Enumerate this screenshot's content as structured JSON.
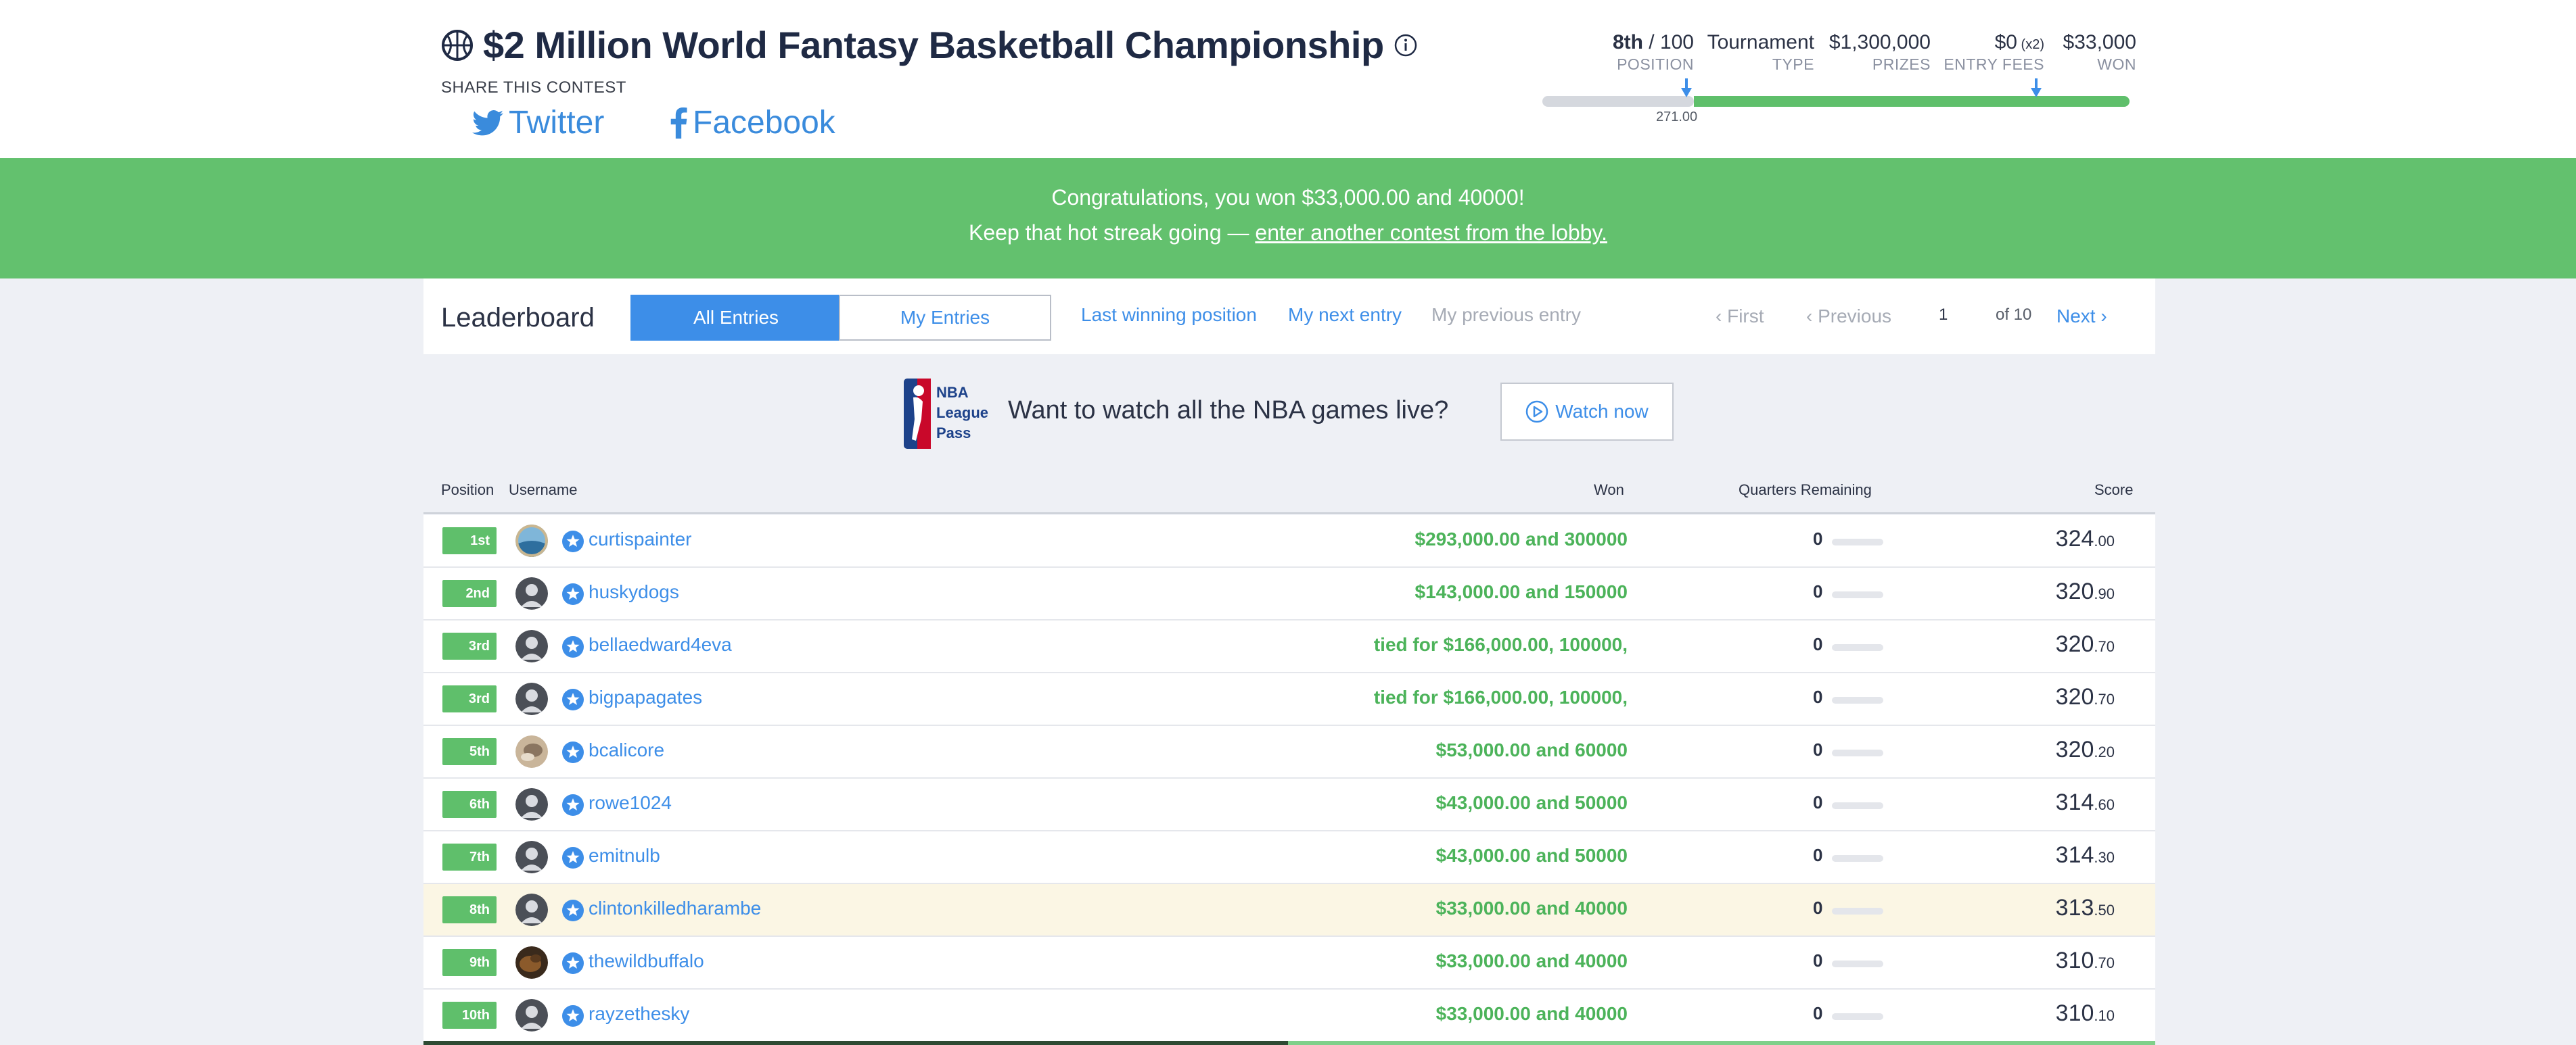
{
  "header": {
    "title": "$2 Million World Fantasy Basketball Championship",
    "share_label": "SHARE THIS CONTEST",
    "twitter_label": "Twitter",
    "facebook_label": "Facebook"
  },
  "stats": {
    "position_value": "8th",
    "position_total": " / 100",
    "position_label": "POSITION",
    "type_value": "Tournament",
    "type_label": "TYPE",
    "prizes_value": "$1,300,000",
    "prizes_label": "PRIZES",
    "entry_value": "$0",
    "entry_mult": " (x2)",
    "entry_label": "ENTRY FEES",
    "won_value": "$33,000",
    "won_label": "WON",
    "progress_marker_label": "271.00"
  },
  "banner": {
    "line1": "Congratulations, you won $33,000.00 and 40000!",
    "line2_prefix": "Keep that hot streak going — ",
    "line2_link": "enter another contest from the lobby."
  },
  "leaderboard": {
    "title": "Leaderboard",
    "tab_all": "All Entries",
    "tab_my": "My Entries",
    "link_last_winning": "Last winning position",
    "link_next_entry": "My next entry",
    "link_prev_entry": "My previous entry",
    "first": "First",
    "previous": "Previous",
    "page": "1",
    "of": "of 10",
    "next": "Next"
  },
  "promo": {
    "text": "Want to watch all the NBA games live?",
    "button": "Watch now",
    "logo_text": "NBA League Pass"
  },
  "table": {
    "headers": {
      "position": "Position",
      "username": "Username",
      "won": "Won",
      "quarters": "Quarters Remaining",
      "score": "Score"
    },
    "rows": [
      {
        "pos": "1st",
        "user": "curtispainter",
        "won": "$293,000.00 and 300000",
        "q": "0",
        "score_int": "324",
        "score_dec": ".00",
        "avatar": "photo-sky"
      },
      {
        "pos": "2nd",
        "user": "huskydogs",
        "won": "$143,000.00 and 150000",
        "q": "0",
        "score_int": "320",
        "score_dec": ".90",
        "avatar": "default"
      },
      {
        "pos": "3rd",
        "user": "bellaedward4eva",
        "won": "tied for $166,000.00, 100000,",
        "q": "0",
        "score_int": "320",
        "score_dec": ".70",
        "avatar": "default"
      },
      {
        "pos": "3rd",
        "user": "bigpapagates",
        "won": "tied for $166,000.00, 100000,",
        "q": "0",
        "score_int": "320",
        "score_dec": ".70",
        "avatar": "default"
      },
      {
        "pos": "5th",
        "user": "bcalicore",
        "won": "$53,000.00 and 60000",
        "q": "0",
        "score_int": "320",
        "score_dec": ".20",
        "avatar": "photo-tan"
      },
      {
        "pos": "6th",
        "user": "rowe1024",
        "won": "$43,000.00 and 50000",
        "q": "0",
        "score_int": "314",
        "score_dec": ".60",
        "avatar": "default"
      },
      {
        "pos": "7th",
        "user": "emitnulb",
        "won": "$43,000.00 and 50000",
        "q": "0",
        "score_int": "314",
        "score_dec": ".30",
        "avatar": "default"
      },
      {
        "pos": "8th",
        "user": "clintonkilledharambe",
        "won": "$33,000.00 and 40000",
        "q": "0",
        "score_int": "313",
        "score_dec": ".50",
        "avatar": "default",
        "highlight": true
      },
      {
        "pos": "9th",
        "user": "thewildbuffalo",
        "won": "$33,000.00 and 40000",
        "q": "0",
        "score_int": "310",
        "score_dec": ".70",
        "avatar": "photo-brown"
      },
      {
        "pos": "10th",
        "user": "rayzethesky",
        "won": "$33,000.00 and 40000",
        "q": "0",
        "score_int": "310",
        "score_dec": ".10",
        "avatar": "default"
      }
    ]
  },
  "colors": {
    "accent": "#3d8ee8",
    "success": "#63c16e",
    "title": "#1f2a44"
  }
}
